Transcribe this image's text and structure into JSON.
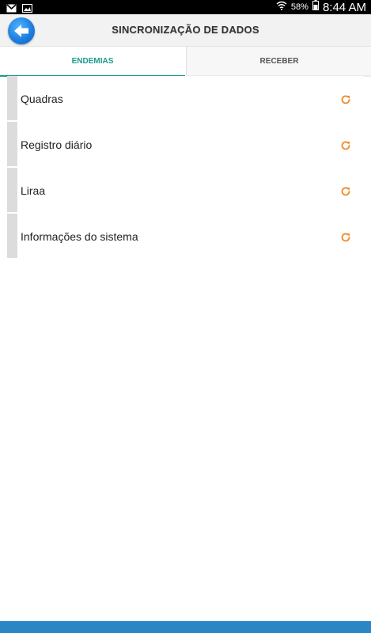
{
  "status_bar": {
    "battery": "58%",
    "time": "8:44 AM"
  },
  "header": {
    "title": "SINCRONIZAÇÃO DE DADOS"
  },
  "tabs": [
    {
      "label": "ENDEMIAS",
      "active": true
    },
    {
      "label": "RECEBER",
      "active": false
    }
  ],
  "list": {
    "items": [
      {
        "label": "Quadras",
        "icon": "sync-icon"
      },
      {
        "label": "Registro diário",
        "icon": "sync-icon"
      },
      {
        "label": "Liraa",
        "icon": "sync-icon"
      },
      {
        "label": "Informações do sistema",
        "icon": "sync-icon"
      }
    ]
  },
  "colors": {
    "accent": "#1a9c8c",
    "sync_icon": "#f08a24",
    "bottom_bar": "#2b86c5",
    "back_button": "#1f7fe0"
  }
}
